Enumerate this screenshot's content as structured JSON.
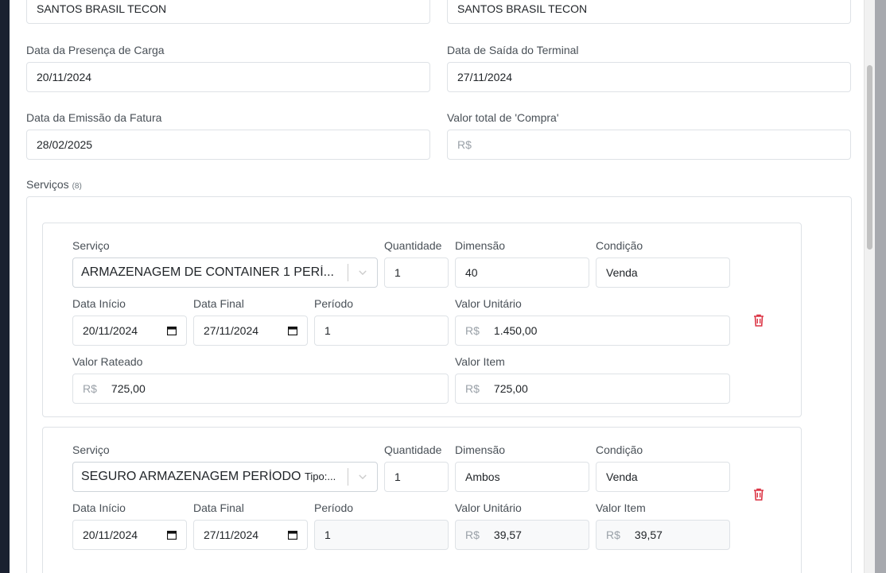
{
  "top_row": {
    "left_value": "SANTOS BRASIL TECON",
    "right_value": "SANTOS BRASIL TECON"
  },
  "form": {
    "presenca_label": "Data da Presença de Carga",
    "presenca_value": "20/11/2024",
    "saida_label": "Data de Saída do Terminal",
    "saida_value": "27/11/2024",
    "emissao_label": "Data da Emissão da Fatura",
    "emissao_value": "28/02/2025",
    "valor_compra_label": "Valor total de 'Compra'",
    "valor_compra_prefix": "R$",
    "valor_compra_value": ""
  },
  "services": {
    "title": "Serviços",
    "count": "(8)",
    "items": [
      {
        "servico_label": "Serviço",
        "servico_value": "ARMAZENAGEM DE CONTAINER 1 PERÍ...",
        "servico_tipo": "",
        "quantidade_label": "Quantidade",
        "quantidade_value": "1",
        "dimensao_label": "Dimensão",
        "dimensao_value": "40",
        "condicao_label": "Condição",
        "condicao_value": "Venda",
        "inicio_label": "Data Início",
        "inicio_value": "20/11/2024",
        "final_label": "Data Final",
        "final_value": "27/11/2024",
        "periodo_label": "Período",
        "periodo_value": "1",
        "unitario_label": "Valor Unitário",
        "unitario_prefix": "R$",
        "unitario_value": "1.450,00",
        "rateado_label": "Valor Rateado",
        "rateado_prefix": "R$",
        "rateado_value": "725,00",
        "item_label": "Valor Item",
        "item_prefix": "R$",
        "item_value": "725,00"
      },
      {
        "servico_label": "Serviço",
        "servico_value": "SEGURO ARMAZENAGEM PERÍODO",
        "servico_tipo": "Tipo:...",
        "quantidade_label": "Quantidade",
        "quantidade_value": "1",
        "dimensao_label": "Dimensão",
        "dimensao_value": "Ambos",
        "condicao_label": "Condição",
        "condicao_value": "Venda",
        "inicio_label": "Data Início",
        "inicio_value": "20/11/2024",
        "final_label": "Data Final",
        "final_value": "27/11/2024",
        "periodo_label": "Período",
        "periodo_value": "1",
        "unitario_label": "Valor Unitário",
        "unitario_prefix": "R$",
        "unitario_value": "39,57",
        "item_label": "Valor Item",
        "item_prefix": "R$",
        "item_value": "39,57"
      }
    ]
  },
  "colors": {
    "delete_icon": "#dc3545",
    "border": "#dee2e6",
    "label": "#495057"
  },
  "icons": {
    "delete": "trash-icon",
    "calendar": "calendar-icon",
    "dropdown": "chevron-down-icon"
  }
}
